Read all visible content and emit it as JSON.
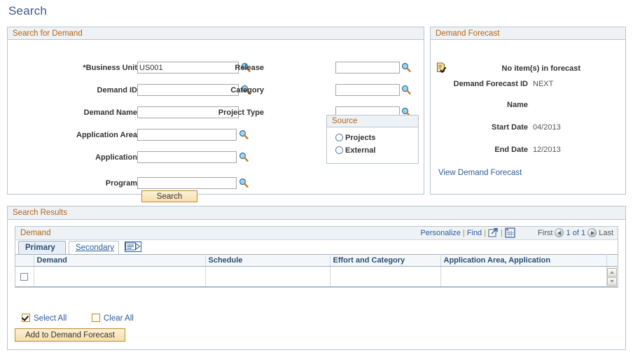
{
  "page": {
    "title": "Search"
  },
  "search_panel": {
    "header": "Search for Demand",
    "fields_left": [
      {
        "label": "*Business Unit",
        "value": "US001",
        "lookup": true
      },
      {
        "label": "Demand ID",
        "value": "",
        "lookup": true
      },
      {
        "label": "Demand Name",
        "value": "",
        "lookup": false
      },
      {
        "label": "Application Area",
        "value": "",
        "lookup": true
      },
      {
        "label": "Application",
        "value": "",
        "lookup": true
      },
      {
        "label": "Program",
        "value": "",
        "lookup": true
      }
    ],
    "fields_right": [
      {
        "label": "Release",
        "value": "",
        "lookup": true
      },
      {
        "label": "Category",
        "value": "",
        "lookup": true
      },
      {
        "label": "Project Type",
        "value": "",
        "lookup": true
      }
    ],
    "source": {
      "header": "Source",
      "options": [
        {
          "label": "Projects",
          "selected": false
        },
        {
          "label": "External",
          "selected": false
        }
      ]
    },
    "search_button": "Search"
  },
  "forecast_panel": {
    "header": "Demand Forecast",
    "status": "No item(s) in forecast",
    "rows": [
      {
        "label": "Demand Forecast ID",
        "value": "NEXT"
      },
      {
        "label": "Name",
        "value": ""
      },
      {
        "label": "Start Date",
        "value": "04/2013"
      },
      {
        "label": "End Date",
        "value": "12/2013"
      }
    ],
    "link": "View Demand Forecast"
  },
  "results_panel": {
    "header": "Search Results",
    "grid_title": "Demand",
    "links": {
      "personalize": "Personalize",
      "find": "Find",
      "separator": "|"
    },
    "nav": {
      "first": "First",
      "counter": "1 of 1",
      "last": "Last"
    },
    "tabs": [
      {
        "label": "Primary",
        "active": true
      },
      {
        "label": "Secondary",
        "active": false
      }
    ],
    "columns": [
      "Demand",
      "Schedule",
      "Effort and Category",
      "Application Area, Application"
    ],
    "rows": [
      {
        "checked": false,
        "demand": "",
        "schedule": "",
        "effort": "",
        "application": ""
      }
    ],
    "select_all": "Select All",
    "clear_all": "Clear All",
    "select_all_checked": true,
    "clear_all_checked": false,
    "add_button": "Add to Demand Forecast"
  },
  "colors": {
    "title": "#3d5a80",
    "group_header_text": "#b2651a",
    "link": "#2b5c9e",
    "button_border": "#c08a2e"
  }
}
